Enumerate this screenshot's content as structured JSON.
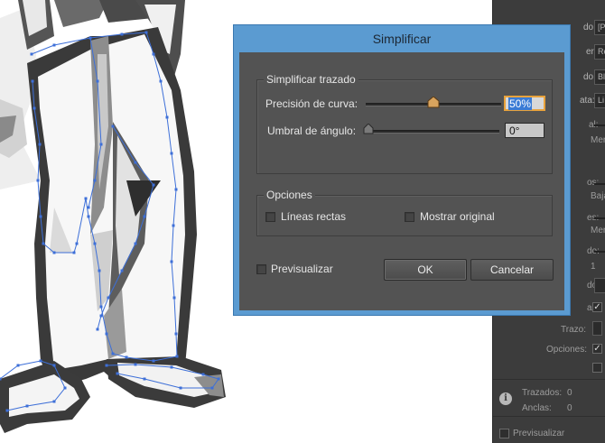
{
  "dialog": {
    "title": "Simplificar",
    "path_group": {
      "title": "Simplificar trazado",
      "curve_precision_label": "Precisión de curva:",
      "curve_precision_value": "50%",
      "curve_precision_level": 0.5,
      "angle_threshold_label": "Umbral de ángulo:",
      "angle_threshold_value": "0°",
      "angle_threshold_level": 0
    },
    "options_group": {
      "title": "Opciones",
      "straight_lines_label": "Líneas rectas",
      "straight_lines_checked": false,
      "show_original_label": "Mostrar original",
      "show_original_checked": false
    },
    "preview_label": "Previsualizar",
    "preview_checked": false,
    "ok_label": "OK",
    "cancel_label": "Cancelar"
  },
  "side_panel": {
    "row_labels": [
      "do:",
      "er:",
      "do:",
      "ata:"
    ],
    "select_values": [
      "[P",
      "Re",
      "Bl",
      "Li"
    ],
    "partial_labels": [
      "al:",
      "Mer",
      "os:",
      "Baja",
      "es:",
      "Mer",
      "do:",
      "1",
      "do:",
      "ar:",
      "Trazo:",
      "Opciones:"
    ],
    "info": {
      "paths_label": "Trazados:",
      "paths_value": "0",
      "anchors_label": "Anclas:",
      "anchors_value": "0"
    },
    "preview_label": "Previsualizar"
  },
  "colors": {
    "dialog_frame": "#5b9bd1",
    "dialog_body": "#535353",
    "panel_bg": "#3c3c3c",
    "active_field_border": "#e8a23c",
    "path_anchor": "#3d6fd8"
  }
}
